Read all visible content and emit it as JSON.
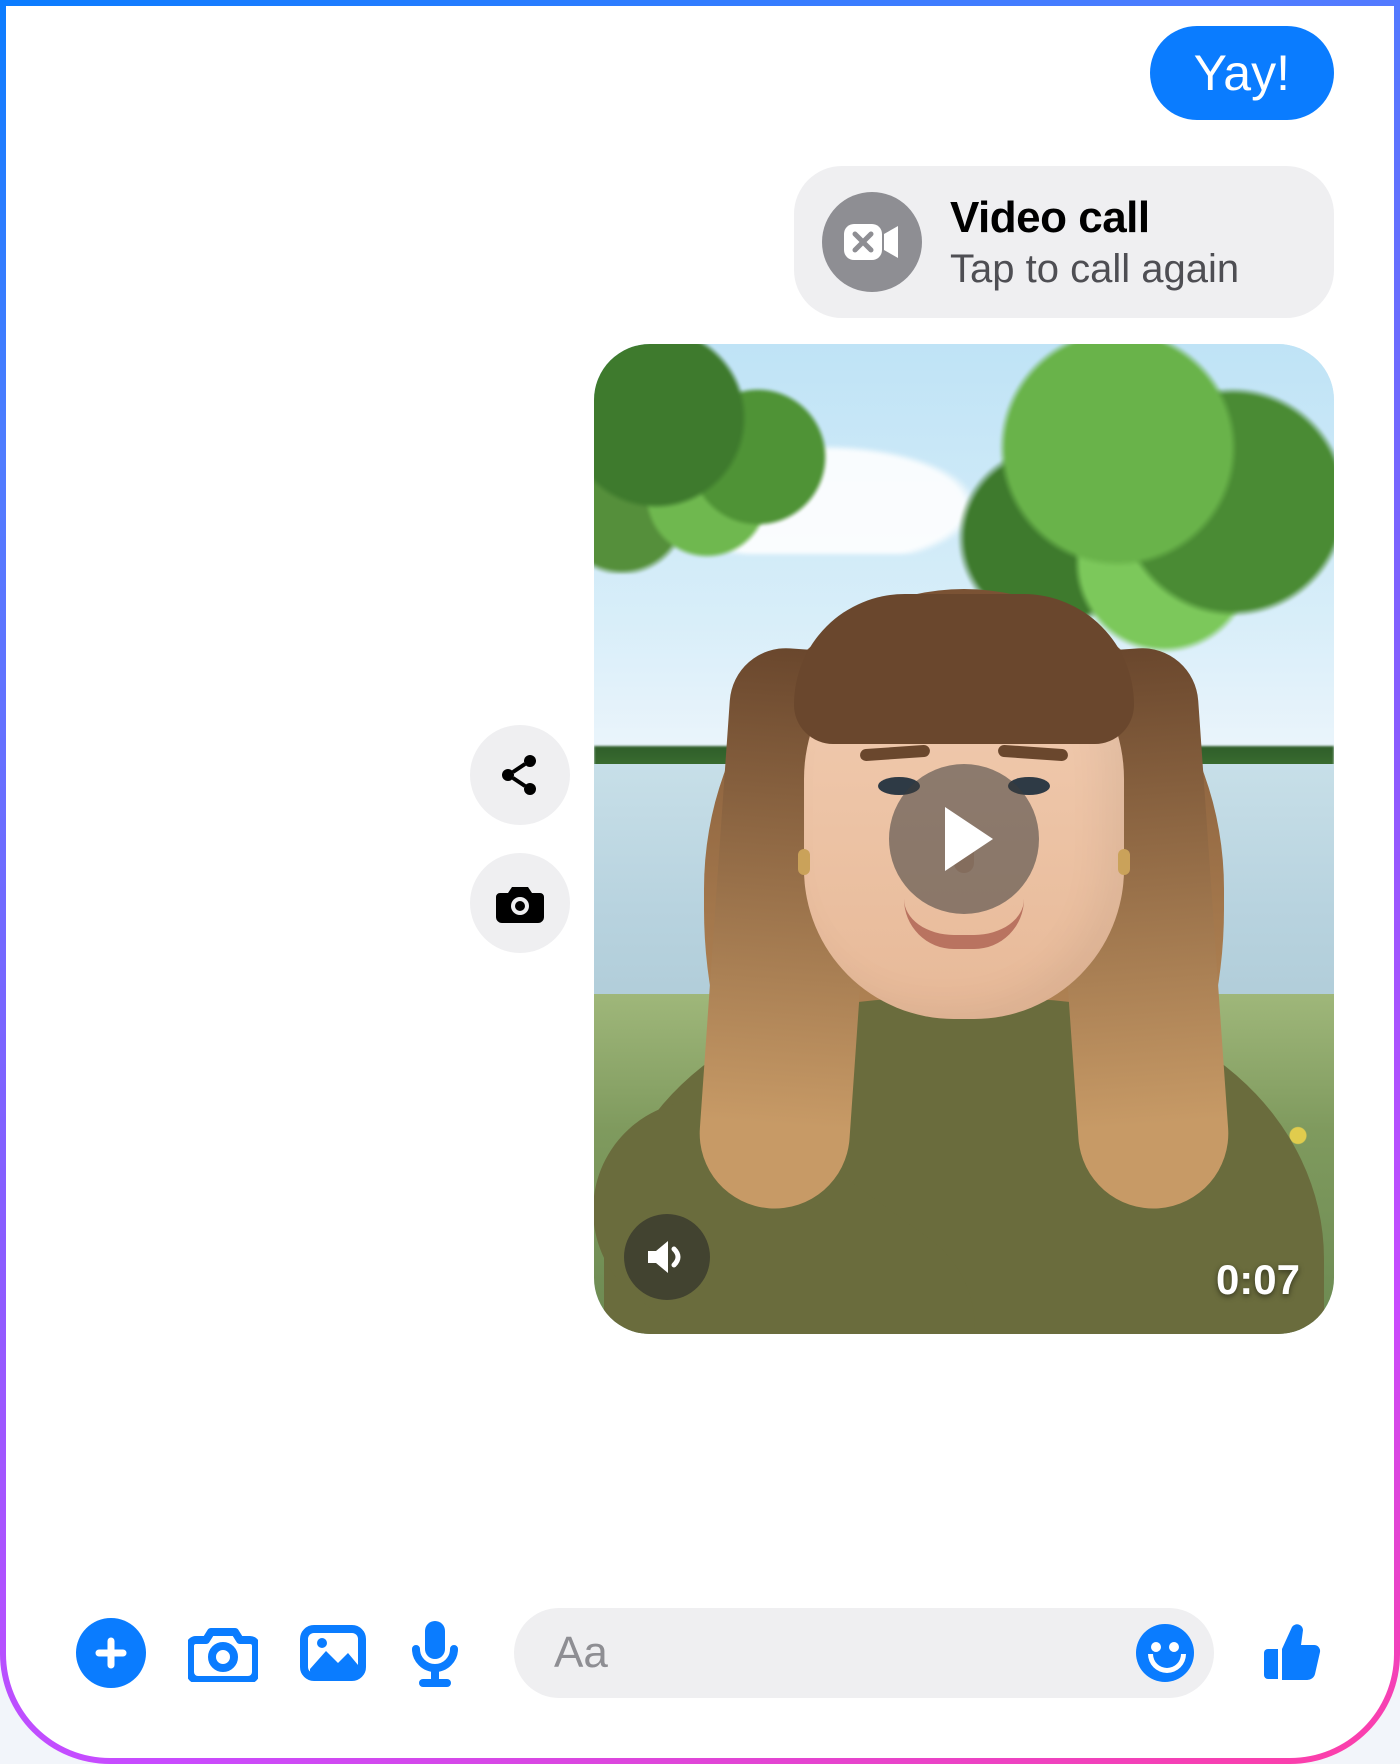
{
  "chat": {
    "outgoing_bubble": "Yay!",
    "call_card": {
      "title": "Video call",
      "subtitle": "Tap to call again"
    },
    "video_message": {
      "duration": "0:07"
    }
  },
  "composer": {
    "placeholder": "Aa"
  },
  "colors": {
    "accent": "#0a7cff"
  }
}
